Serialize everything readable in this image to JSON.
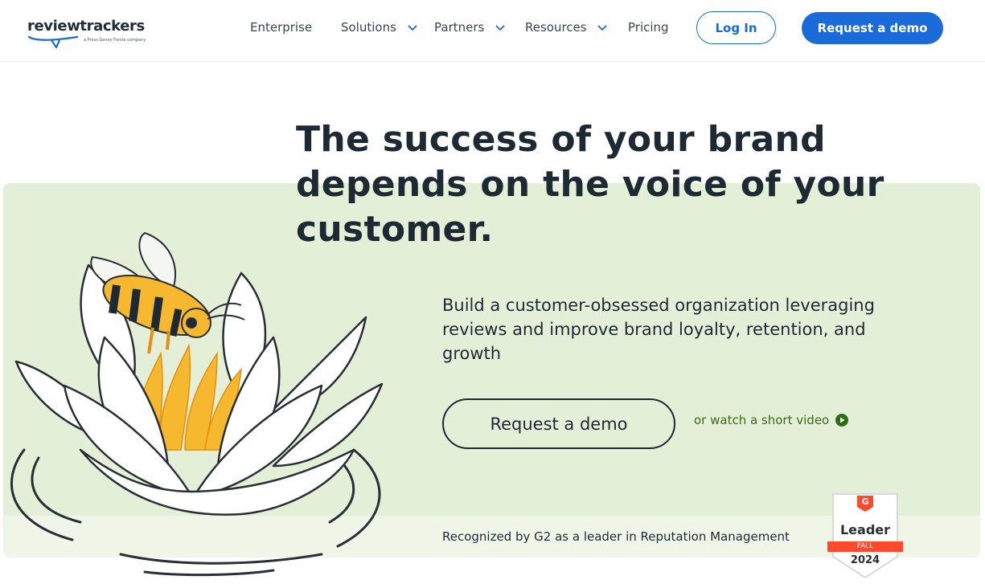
{
  "header": {
    "logo": {
      "word": "reviewtrackers",
      "tagline": "a Press Ganey Forsta company"
    },
    "nav": [
      {
        "label": "Enterprise",
        "has_dropdown": false
      },
      {
        "label": "Solutions",
        "has_dropdown": true
      },
      {
        "label": "Partners",
        "has_dropdown": true
      },
      {
        "label": "Resources",
        "has_dropdown": true
      },
      {
        "label": "Pricing",
        "has_dropdown": false
      }
    ],
    "login_label": "Log In",
    "demo_label": "Request a demo"
  },
  "hero": {
    "headline": "The success of your brand depends on the voice of your customer.",
    "subtext": "Build a customer-obsessed organization leveraging reviews and improve brand loyalty, retention, and growth",
    "cta_label": "Request a demo",
    "video_link": "or watch a short video",
    "recognized": "Recognized by G2 as a leader in Reputation Management"
  },
  "badge": {
    "brand": "G",
    "title": "Leader",
    "season": "FALL",
    "year": "2024"
  },
  "colors": {
    "brand_blue": "#1b6ad9",
    "hero_green": "#e3efd6",
    "text_dark": "#1e2a33",
    "link_green": "#3b6b16",
    "bee_yellow": "#f5b82e",
    "g2_red": "#ff492c"
  }
}
